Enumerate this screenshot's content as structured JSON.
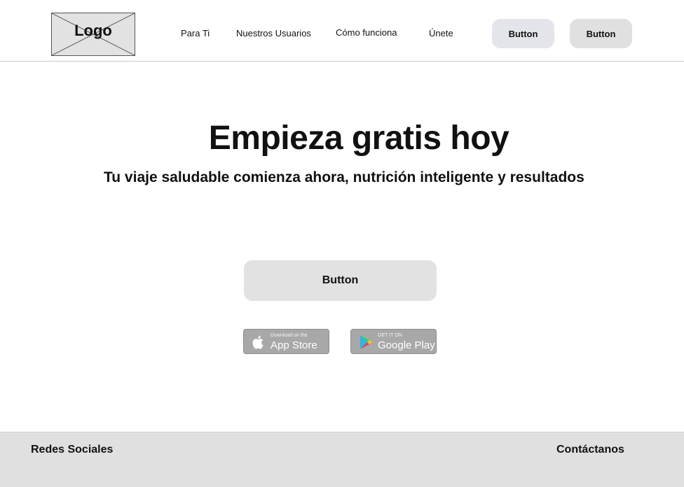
{
  "header": {
    "logo_text": "Logo",
    "nav": {
      "item1": "Para Ti",
      "item2": "Nuestros Usuarios",
      "item3": "Cómo funciona",
      "item4": "Únete"
    },
    "button1_label": "Button",
    "button2_label": "Button"
  },
  "hero": {
    "title": "Empieza gratis hoy",
    "subtitle": "Tu viaje saludable comienza ahora, nutrición inteligente y resultados",
    "button_label": "Button"
  },
  "badges": {
    "apple": {
      "small": "Download on the",
      "big": "App Store",
      "icon": "apple-icon"
    },
    "google": {
      "small": "GET IT ON",
      "big": "Google Play",
      "icon": "google-play-icon"
    }
  },
  "footer": {
    "left_label": "Redes Sociales",
    "right_label": "Contáctanos"
  },
  "colors": {
    "placeholder_gray": "#e2e2e2",
    "badge_gray": "#a8a8a8",
    "text": "#111111"
  }
}
